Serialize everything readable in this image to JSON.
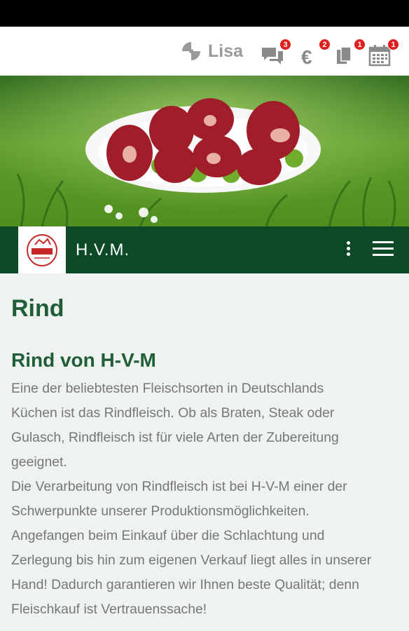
{
  "topbar": {
    "user_name": "Lisa",
    "badges": {
      "messages": "3",
      "payments": "2",
      "documents": "1",
      "calendar": "1"
    }
  },
  "navbar": {
    "brand": "H.V.M."
  },
  "article": {
    "title": "Rind",
    "subtitle": "Rind von H-V-M",
    "lines": [
      "Eine der beliebtesten Fleischsorten in Deutschlands",
      "Küchen ist das Rindfleisch. Ob als Braten, Steak oder",
      "Gulasch, Rindfleisch ist für viele Arten der Zubereitung",
      "geeignet.",
      "Die Verarbeitung von Rindfleisch ist bei H-V-M einer der",
      "Schwerpunkte unserer Produktionsmöglichkeiten.",
      "Angefangen beim Einkauf über die Schlachtung und",
      "Zerlegung bis hin zum eigenen Verkauf liegt alles in unserer",
      "Hand! Dadurch garantieren wir Ihnen beste Qualität; denn",
      "Fleischkauf ist Vertrauenssache!"
    ]
  },
  "colors": {
    "nav_green": "#0c4a27",
    "title_green": "#1f5e36",
    "badge_red": "#e11d1d"
  }
}
